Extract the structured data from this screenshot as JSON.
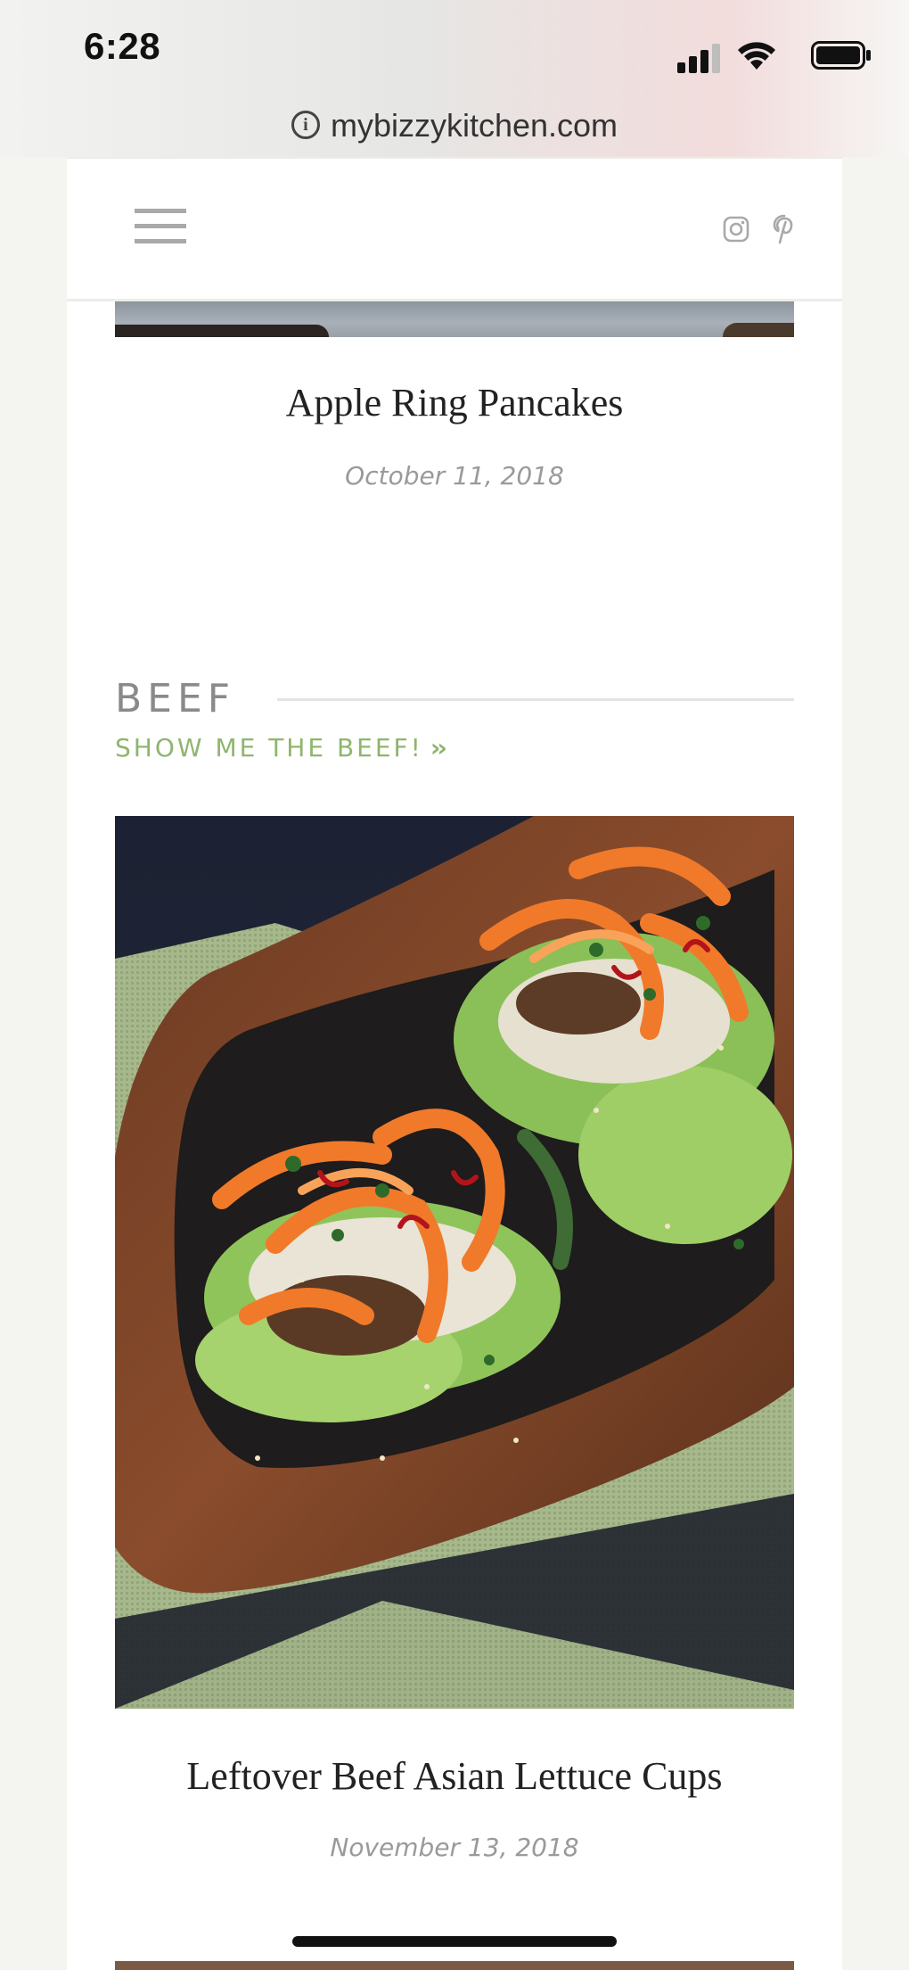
{
  "status_bar": {
    "time": "6:28",
    "icons": [
      "cellular-signal-icon",
      "wifi-icon",
      "battery-icon"
    ]
  },
  "browser": {
    "url": "mybizzykitchen.com",
    "info_icon": "info-icon"
  },
  "header": {
    "menu_icon": "hamburger-menu-icon",
    "social": [
      "instagram-icon",
      "pinterest-icon"
    ]
  },
  "previous_post": {
    "title": "Apple Ring Pancakes",
    "date": "October 11, 2018"
  },
  "section": {
    "heading": "BEEF",
    "link_label": "SHOW ME THE BEEF!",
    "link_icon": "double-chevron-right-icon"
  },
  "featured_post": {
    "title": "Leftover Beef Asian Lettuce Cups",
    "date": "November 13, 2018"
  },
  "colors": {
    "accent_green": "#8fb56e",
    "heading_gray": "#8a8a8a",
    "date_gray": "#9a9a9a",
    "title_dark": "#222222"
  }
}
